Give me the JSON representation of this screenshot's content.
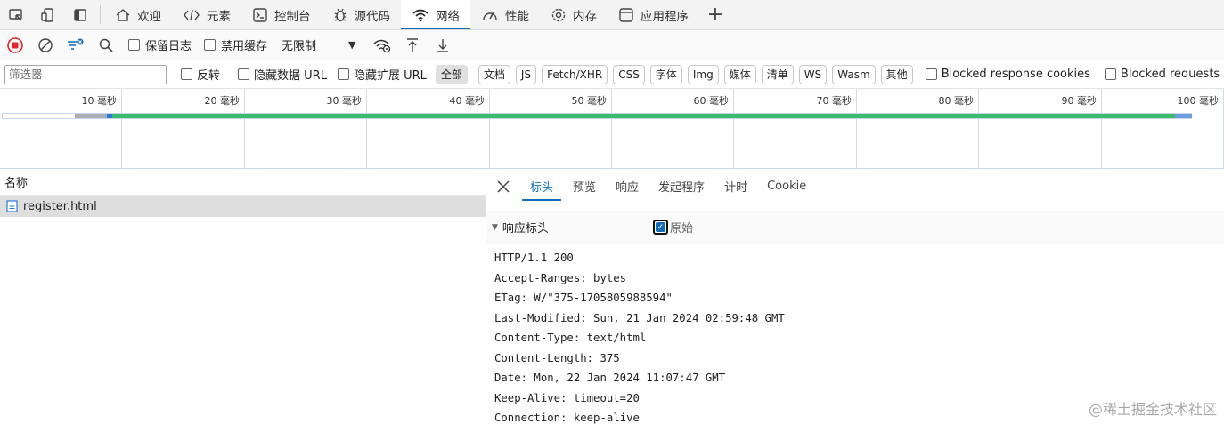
{
  "tabbar": {
    "tabs": [
      {
        "label": "欢迎",
        "icon": "home-icon"
      },
      {
        "label": "元素",
        "icon": "code-icon"
      },
      {
        "label": "控制台",
        "icon": "console-icon"
      },
      {
        "label": "源代码",
        "icon": "bug-icon"
      },
      {
        "label": "网络",
        "icon": "wifi-icon"
      },
      {
        "label": "性能",
        "icon": "gauge-icon"
      },
      {
        "label": "内存",
        "icon": "gear-icon"
      },
      {
        "label": "应用程序",
        "icon": "app-icon"
      }
    ],
    "active_tab": "网络"
  },
  "toolbar": {
    "preserve_log": "保留日志",
    "disable_cache": "禁用缓存",
    "throttling": "无限制"
  },
  "filterbar": {
    "filter_placeholder": "筛选器",
    "invert": "反转",
    "hide_data_urls": "隐藏数据 URL",
    "hide_extension_urls": "隐藏扩展 URL",
    "types": [
      "全部",
      "文档",
      "JS",
      "Fetch/XHR",
      "CSS",
      "字体",
      "Img",
      "媒体",
      "清单",
      "WS",
      "Wasm",
      "其他"
    ],
    "selected_type": "全部",
    "blocked_cookies": "Blocked response cookies",
    "blocked_requests": "Blocked requests"
  },
  "overview": {
    "ticks": [
      "10 毫秒",
      "20 毫秒",
      "30 毫秒",
      "40 毫秒",
      "50 毫秒",
      "60 毫秒",
      "70 毫秒",
      "80 毫秒",
      "90 毫秒",
      "100 毫秒"
    ]
  },
  "requests": {
    "column_name": "名称",
    "rows": [
      {
        "name": "register.html"
      }
    ]
  },
  "details": {
    "tabs": [
      "标头",
      "预览",
      "响应",
      "发起程序",
      "计时",
      "Cookie"
    ],
    "active_tab": "标头",
    "section_title": "响应标头",
    "raw_label": "原始",
    "raw_checked": true,
    "header_lines": [
      "HTTP/1.1 200",
      "Accept-Ranges: bytes",
      "ETag: W/\"375-1705805988594\"",
      "Last-Modified: Sun, 21 Jan 2024 02:59:48 GMT",
      "Content-Type: text/html",
      "Content-Length: 375",
      "Date: Mon, 22 Jan 2024 11:07:47 GMT",
      "Keep-Alive: timeout=20",
      "Connection: keep-alive"
    ]
  },
  "watermark": "@稀土掘金技术社区",
  "colors": {
    "accent": "#0f6cbd",
    "record_red": "#e0262b",
    "waterfall_green": "#3aba6a"
  }
}
